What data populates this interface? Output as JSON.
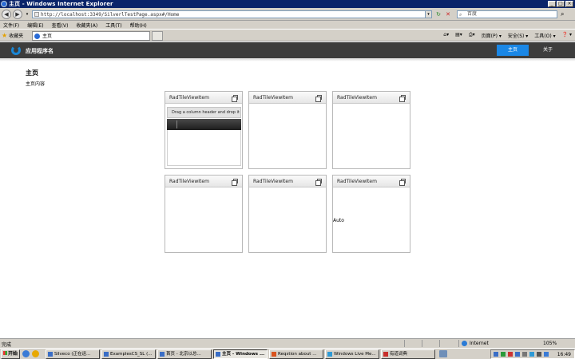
{
  "window": {
    "title": "主页 - Windows Internet Explorer"
  },
  "address_bar": {
    "url": "http://localhost:3349/SilverlTestPage.aspx#/Home",
    "search_placeholder": "百度"
  },
  "menu": {
    "items": [
      "文件(F)",
      "编辑(E)",
      "查看(V)",
      "收藏夹(A)",
      "工具(T)",
      "帮助(H)"
    ]
  },
  "favorites_bar": {
    "favorites_label": "收藏夹",
    "tab_label": "主页",
    "commands": [
      "页面(P) ▾",
      "安全(S) ▾",
      "工具(O) ▾",
      "❓ ▾"
    ]
  },
  "app": {
    "name": "应用程序名",
    "nav": {
      "home": "主页",
      "about": "关于"
    },
    "page_title": "主页",
    "page_subtitle": "主页内容"
  },
  "tiles": [
    {
      "title": "RadTileViewItem",
      "grid_drag_text": "Drag a column header and drop it here to group by that column"
    },
    {
      "title": "RadTileViewItem"
    },
    {
      "title": "RadTileViewItem"
    },
    {
      "title": "RadTileViewItem"
    },
    {
      "title": "RadTileViewItem"
    },
    {
      "title": "RadTileViewItem",
      "content": "Auto"
    }
  ],
  "status_bar": {
    "text": "完成",
    "zone": "Internet",
    "zoom": "105%"
  },
  "taskbar": {
    "start_label": "开始",
    "tasks": [
      {
        "label": "Silveco (正在运..."
      },
      {
        "label": "ExamplesCS_SL (..."
      },
      {
        "label": "首页 - 北京以总..."
      },
      {
        "label": "主页 - Windows ..."
      },
      {
        "label": "Reqstion about ..."
      },
      {
        "label": "Windows Live Me..."
      },
      {
        "label": "有道词典"
      }
    ],
    "clock": "16:49"
  }
}
